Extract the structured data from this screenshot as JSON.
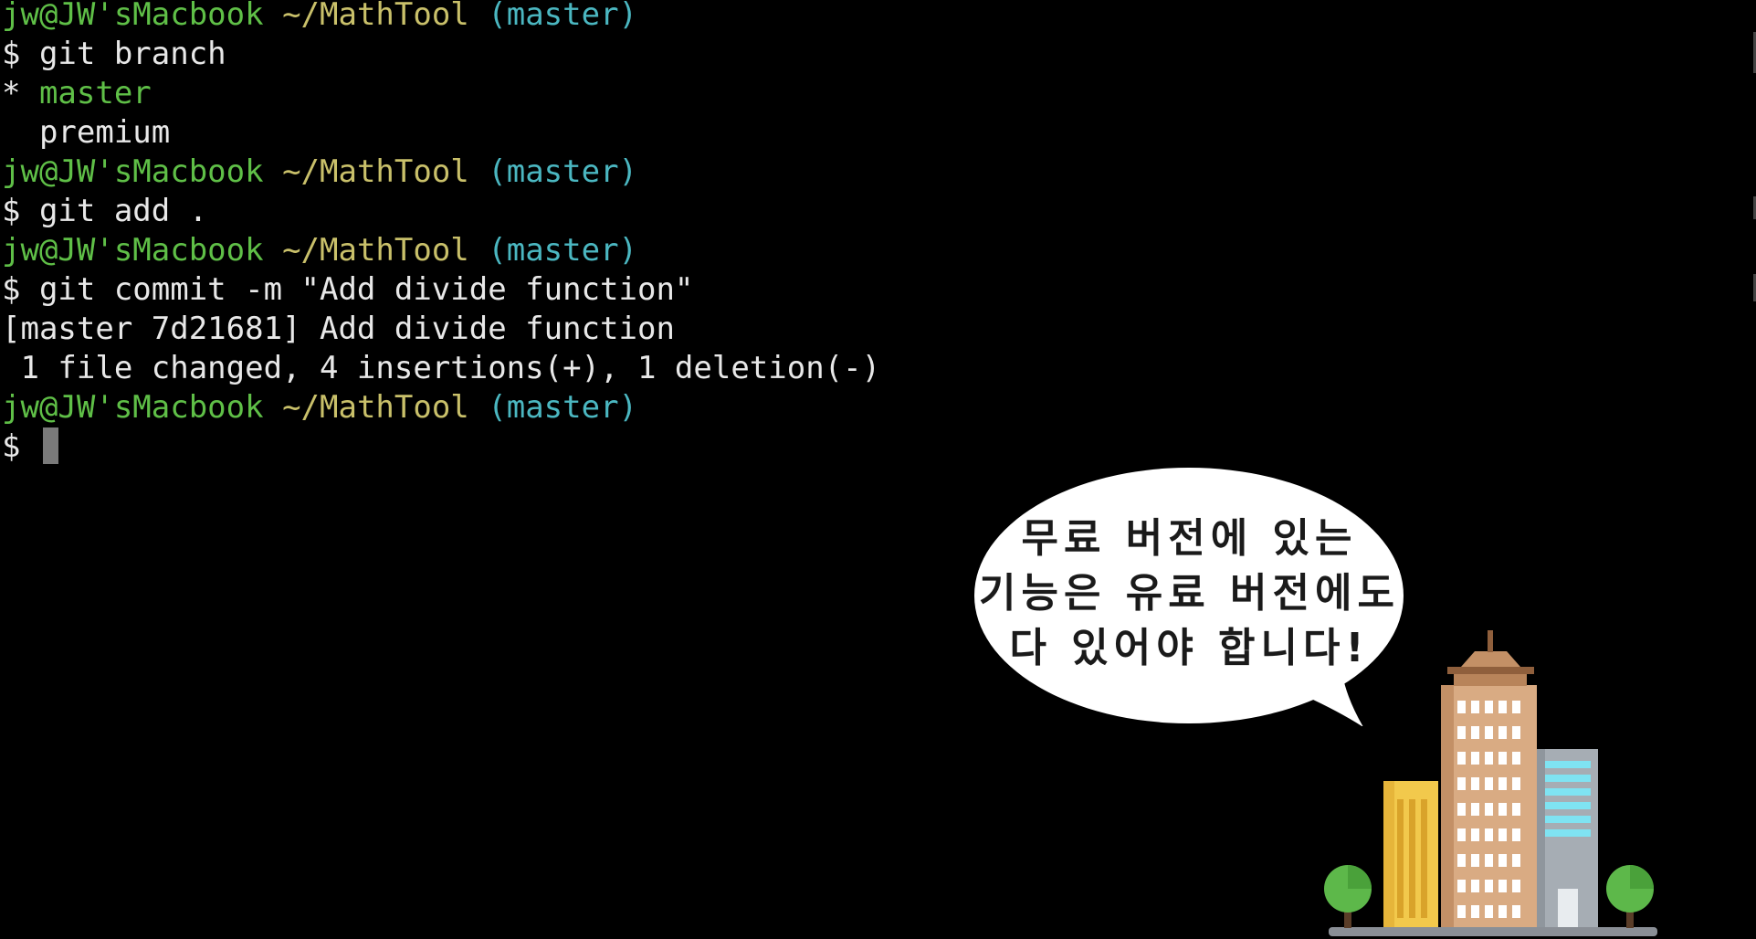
{
  "terminal": {
    "lines": [
      {
        "user": "jw@JW'sMacbook",
        "path": "~/MathTool",
        "branch": "(master)"
      },
      {
        "cmd": "$ git branch"
      },
      {
        "star": "* ",
        "name": "master"
      },
      {
        "plain": "  premium"
      },
      {
        "user": "jw@JW'sMacbook",
        "path": "~/MathTool",
        "branch": "(master)"
      },
      {
        "cmd": "$ git add ."
      },
      {
        "user": "jw@JW'sMacbook",
        "path": "~/MathTool",
        "branch": "(master)"
      },
      {
        "cmd": "$ git commit -m \"Add divide function\""
      },
      {
        "plain": "[master 7d21681] Add divide function"
      },
      {
        "plain": " 1 file changed, 4 insertions(+), 1 deletion(-)"
      },
      {
        "user": "jw@JW'sMacbook",
        "path": "~/MathTool",
        "branch": "(master)"
      },
      {
        "prompt": "$"
      }
    ]
  },
  "bubble": {
    "lines": [
      "무료 버전에 있는",
      "기능은 유료 버전에도",
      "다 있어야 합니다!"
    ]
  },
  "colors": {
    "background": "#000000",
    "user": "#5fbf47",
    "path": "#c9c06a",
    "branch": "#4bb7c1",
    "text": "#e8e8e8"
  },
  "icons": [
    "speech-bubble-icon",
    "city-buildings-icon",
    "tree-icon"
  ]
}
